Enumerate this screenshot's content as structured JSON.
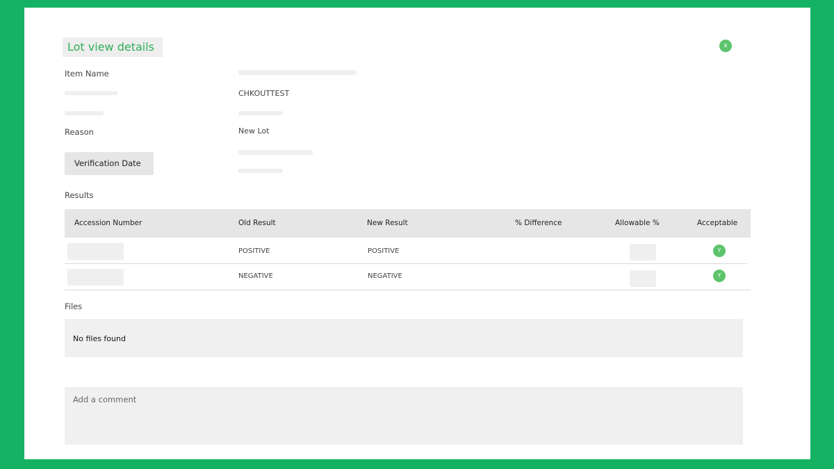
{
  "dialog": {
    "title": "Lot view details",
    "close_label": "x"
  },
  "details": {
    "item_name_label": "Item Name",
    "item_value": "CHKOUTTEST",
    "reason_label": "Reason",
    "reason_value": "New Lot",
    "verification_date_button": "Verification Date"
  },
  "results": {
    "section_label": "Results",
    "columns": [
      "Accession Number",
      "Old Result",
      "New Result",
      "% Difference",
      "Allowable %",
      "Acceptable"
    ],
    "rows": [
      {
        "old_result": "POSITIVE",
        "new_result": "POSITIVE",
        "acceptable": "Y"
      },
      {
        "old_result": "NEGATIVE",
        "new_result": "NEGATIVE",
        "acceptable": "Y"
      }
    ]
  },
  "files": {
    "section_label": "Files",
    "empty_text": "No files found"
  },
  "comment": {
    "placeholder": "Add a comment"
  },
  "colors": {
    "frame": "#15b263",
    "accent": "#2fae59",
    "badge": "#5dc46c"
  }
}
